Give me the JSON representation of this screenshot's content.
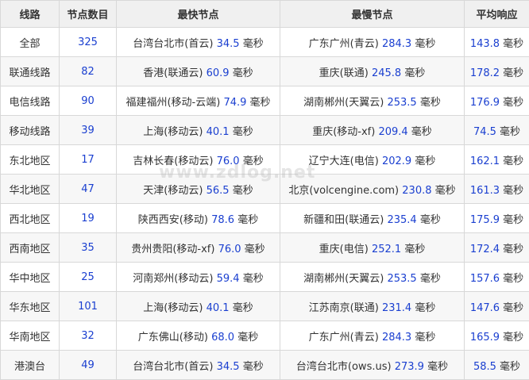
{
  "columns": [
    "线路",
    "节点数目",
    "最快节点",
    "最慢节点",
    "平均响应"
  ],
  "watermark": "www.zdlog.net",
  "colors": {
    "number": "#1a3fd0",
    "text": "#333333",
    "header_bg": "#f0f0f0",
    "border": "#d8d8d8"
  },
  "rows": [
    {
      "route": "全部",
      "count": "325",
      "fast_name": "台湾台北市(首云)",
      "fast_ms": "34.5",
      "slow_name": "广东广州(青云)",
      "slow_ms": "284.3",
      "avg": "143.8",
      "unit": "毫秒"
    },
    {
      "route": "联通线路",
      "count": "82",
      "fast_name": "香港(联通云)",
      "fast_ms": "60.9",
      "slow_name": "重庆(联通)",
      "slow_ms": "245.8",
      "avg": "178.2",
      "unit": "毫秒"
    },
    {
      "route": "电信线路",
      "count": "90",
      "fast_name": "福建福州(移动-云端)",
      "fast_ms": "74.9",
      "slow_name": "湖南郴州(天翼云)",
      "slow_ms": "253.5",
      "avg": "176.9",
      "unit": "毫秒"
    },
    {
      "route": "移动线路",
      "count": "39",
      "fast_name": "上海(移动云)",
      "fast_ms": "40.1",
      "slow_name": "重庆(移动-xf)",
      "slow_ms": "209.4",
      "avg": "74.5",
      "unit": "毫秒"
    },
    {
      "route": "东北地区",
      "count": "17",
      "fast_name": "吉林长春(移动云)",
      "fast_ms": "76.0",
      "slow_name": "辽宁大连(电信)",
      "slow_ms": "202.9",
      "avg": "162.1",
      "unit": "毫秒"
    },
    {
      "route": "华北地区",
      "count": "47",
      "fast_name": "天津(移动云)",
      "fast_ms": "56.5",
      "slow_name": "北京(volcengine.com)",
      "slow_ms": "230.8",
      "avg": "161.3",
      "unit": "毫秒"
    },
    {
      "route": "西北地区",
      "count": "19",
      "fast_name": "陕西西安(移动)",
      "fast_ms": "78.6",
      "slow_name": "新疆和田(联通云)",
      "slow_ms": "235.4",
      "avg": "175.9",
      "unit": "毫秒"
    },
    {
      "route": "西南地区",
      "count": "35",
      "fast_name": "贵州贵阳(移动-xf)",
      "fast_ms": "76.0",
      "slow_name": "重庆(电信)",
      "slow_ms": "252.1",
      "avg": "172.4",
      "unit": "毫秒"
    },
    {
      "route": "华中地区",
      "count": "25",
      "fast_name": "河南郑州(移动云)",
      "fast_ms": "59.4",
      "slow_name": "湖南郴州(天翼云)",
      "slow_ms": "253.5",
      "avg": "157.6",
      "unit": "毫秒"
    },
    {
      "route": "华东地区",
      "count": "101",
      "fast_name": "上海(移动云)",
      "fast_ms": "40.1",
      "slow_name": "江苏南京(联通)",
      "slow_ms": "231.4",
      "avg": "147.6",
      "unit": "毫秒"
    },
    {
      "route": "华南地区",
      "count": "32",
      "fast_name": "广东佛山(移动)",
      "fast_ms": "68.0",
      "slow_name": "广东广州(青云)",
      "slow_ms": "284.3",
      "avg": "165.9",
      "unit": "毫秒"
    },
    {
      "route": "港澳台",
      "count": "49",
      "fast_name": "台湾台北市(首云)",
      "fast_ms": "34.5",
      "slow_name": "台湾台北市(ows.us)",
      "slow_ms": "273.9",
      "avg": "58.5",
      "unit": "毫秒"
    }
  ]
}
